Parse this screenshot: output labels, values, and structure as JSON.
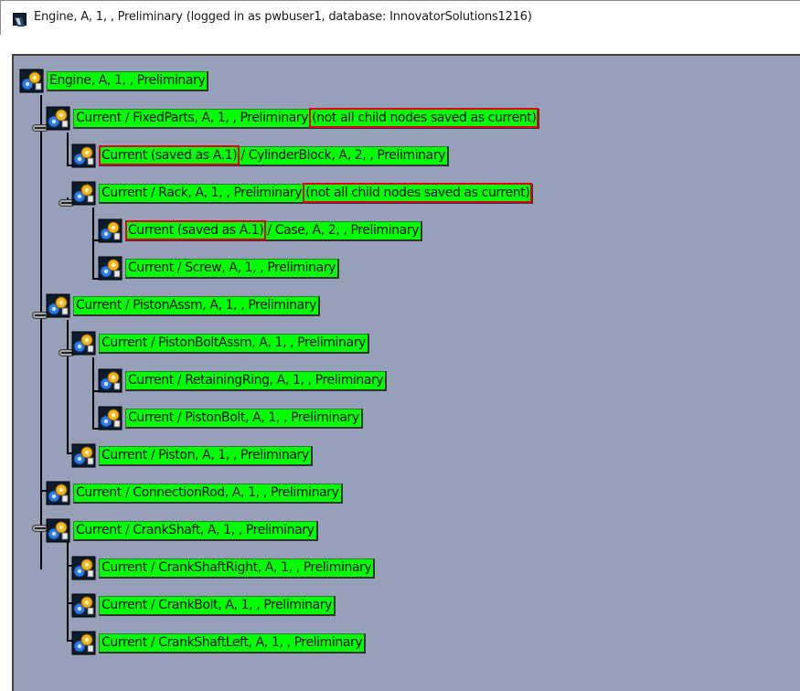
{
  "window": {
    "title": "Engine, A, 1, , Preliminary (logged in as pwbuser1, database: InnovatorSolutions1216)"
  },
  "colors": {
    "node_fill": "#00ff00",
    "highlight_box": "#e0001a",
    "panel_background": "#96a0b8"
  },
  "tree": {
    "nodes": [
      {
        "id": "engine",
        "icon": "assembly-gear-icon",
        "expanded": true,
        "segments": [
          "Engine, A, 1, , Preliminary"
        ]
      },
      {
        "id": "fixedparts",
        "icon": "assembly-gear-icon",
        "expanded": true,
        "segments": [
          "Current / FixedParts, A, 1, , Preliminary ",
          "(not all child nodes saved as current)"
        ]
      },
      {
        "id": "cylinderblock",
        "icon": "part-gear-icon",
        "segments": [
          "Current (saved as A.1)",
          " / CylinderBlock, A, 2, , Preliminary"
        ]
      },
      {
        "id": "rack",
        "icon": "assembly-gear-icon",
        "expanded": true,
        "segments": [
          "Current / Rack, A, 1, , Preliminary ",
          "(not all child nodes saved as current)"
        ]
      },
      {
        "id": "case",
        "icon": "part-gear-icon",
        "segments": [
          "Current (saved as A.1)",
          " / Case, A, 2, , Preliminary"
        ]
      },
      {
        "id": "screw",
        "icon": "part-gear-icon",
        "segments": [
          "Current / Screw, A, 1, , Preliminary"
        ]
      },
      {
        "id": "pistonassm",
        "icon": "assembly-gear-icon",
        "expanded": true,
        "segments": [
          "Current / PistonAssm, A, 1, , Preliminary"
        ]
      },
      {
        "id": "pistonboltassm",
        "icon": "assembly-gear-icon",
        "expanded": true,
        "segments": [
          "Current / PistonBoltAssm, A, 1, , Preliminary"
        ]
      },
      {
        "id": "retainingring",
        "icon": "part-gear-icon",
        "segments": [
          "Current / RetainingRing, A, 1, , Preliminary"
        ]
      },
      {
        "id": "pistonbolt",
        "icon": "part-gear-icon",
        "segments": [
          "Current / PistonBolt, A, 1, , Preliminary"
        ]
      },
      {
        "id": "piston",
        "icon": "part-gear-icon",
        "segments": [
          "Current / Piston, A, 1, , Preliminary"
        ]
      },
      {
        "id": "connectionrod",
        "icon": "part-gear-icon",
        "segments": [
          "Current / ConnectionRod, A, 1, , Preliminary"
        ]
      },
      {
        "id": "crankshaft",
        "icon": "assembly-gear-icon",
        "expanded": true,
        "segments": [
          "Current / CrankShaft, A, 1, , Preliminary"
        ]
      },
      {
        "id": "crankshaftright",
        "icon": "part-gear-icon",
        "segments": [
          "Current / CrankShaftRight, A, 1, , Preliminary"
        ]
      },
      {
        "id": "crankbolt",
        "icon": "part-gear-icon",
        "segments": [
          "Current / CrankBolt, A, 1, , Preliminary"
        ]
      },
      {
        "id": "crankshaftleft",
        "icon": "part-gear-icon",
        "segments": [
          "Current / CrankShaftLeft, A, 1, , Preliminary"
        ]
      }
    ]
  }
}
